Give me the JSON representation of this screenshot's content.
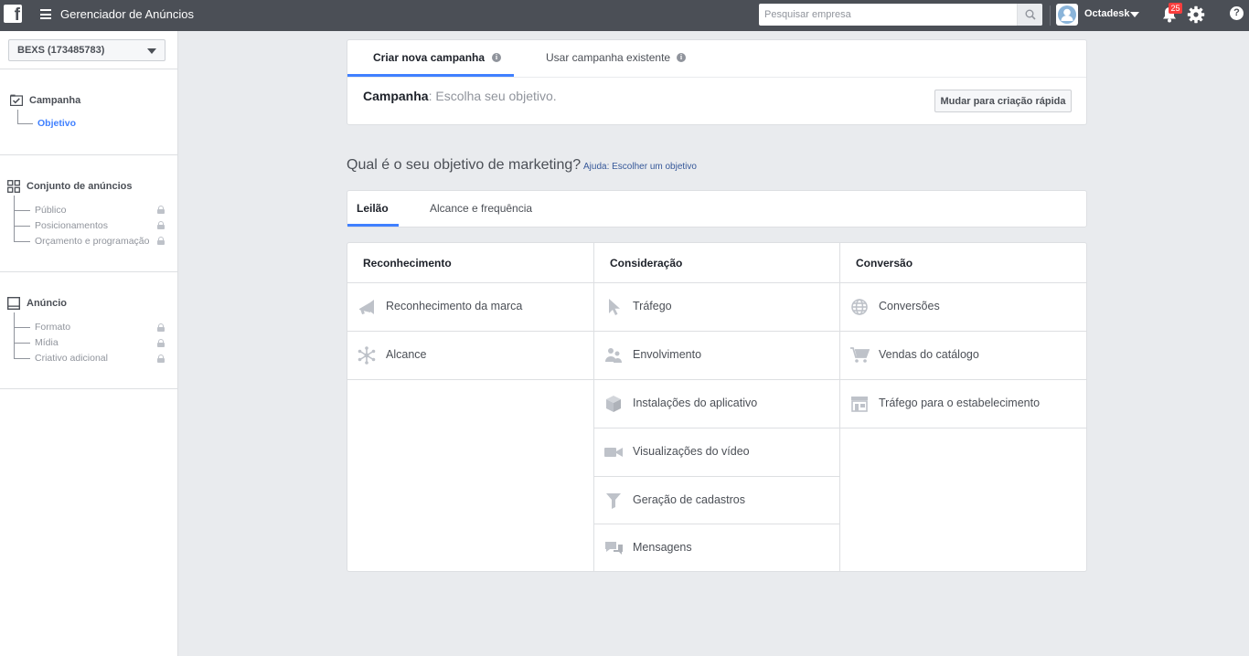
{
  "topbar": {
    "app_title": "Gerenciador de Anúncios",
    "search_placeholder": "Pesquisar empresa",
    "user_name": "Octadesk",
    "notifications_count": "25",
    "help_label": "?"
  },
  "sidebar": {
    "account": "BEXS (173485783)",
    "campaign": {
      "label": "Campanha",
      "items": [
        {
          "label": "Objetivo",
          "active": true
        }
      ]
    },
    "adset": {
      "label": "Conjunto de anúncios",
      "items": [
        {
          "label": "Público"
        },
        {
          "label": "Posicionamentos"
        },
        {
          "label": "Orçamento e programação"
        }
      ]
    },
    "ad": {
      "label": "Anúncio",
      "items": [
        {
          "label": "Formato"
        },
        {
          "label": "Mídia"
        },
        {
          "label": "Criativo adicional"
        }
      ]
    }
  },
  "main": {
    "tabs": {
      "new": "Criar nova campanha",
      "existing": "Usar campanha existente"
    },
    "step_bold": "Campanha",
    "step_rest": ": Escolha seu objetivo.",
    "quick_button": "Mudar para criação rápida",
    "question": "Qual é o seu objetivo de marketing?",
    "help_prefix": "Ajuda:",
    "help_link": "Escolher um objetivo",
    "buy_tabs": {
      "auction": "Leilão",
      "reach_freq": "Alcance e frequência"
    },
    "columns": [
      {
        "title": "Reconhecimento",
        "items": [
          {
            "label": "Reconhecimento da marca",
            "icon": "megaphone-icon"
          },
          {
            "label": "Alcance",
            "icon": "reach-icon"
          }
        ]
      },
      {
        "title": "Consideração",
        "items": [
          {
            "label": "Tráfego",
            "icon": "cursor-icon"
          },
          {
            "label": "Envolvimento",
            "icon": "people-icon"
          },
          {
            "label": "Instalações do aplicativo",
            "icon": "box-icon"
          },
          {
            "label": "Visualizações do vídeo",
            "icon": "video-camera-icon"
          },
          {
            "label": "Geração de cadastros",
            "icon": "funnel-icon"
          },
          {
            "label": "Mensagens",
            "icon": "chat-bubbles-icon"
          }
        ]
      },
      {
        "title": "Conversão",
        "items": [
          {
            "label": "Conversões",
            "icon": "globe-icon"
          },
          {
            "label": "Vendas do catálogo",
            "icon": "cart-icon"
          },
          {
            "label": "Tráfego para o estabelecimento",
            "icon": "store-icon"
          }
        ]
      }
    ]
  },
  "colors": {
    "topbar": "#4b4f56",
    "accent": "#4080ff",
    "link": "#365899",
    "background": "#e9ebee",
    "icon_gray": "#bec2c9"
  }
}
